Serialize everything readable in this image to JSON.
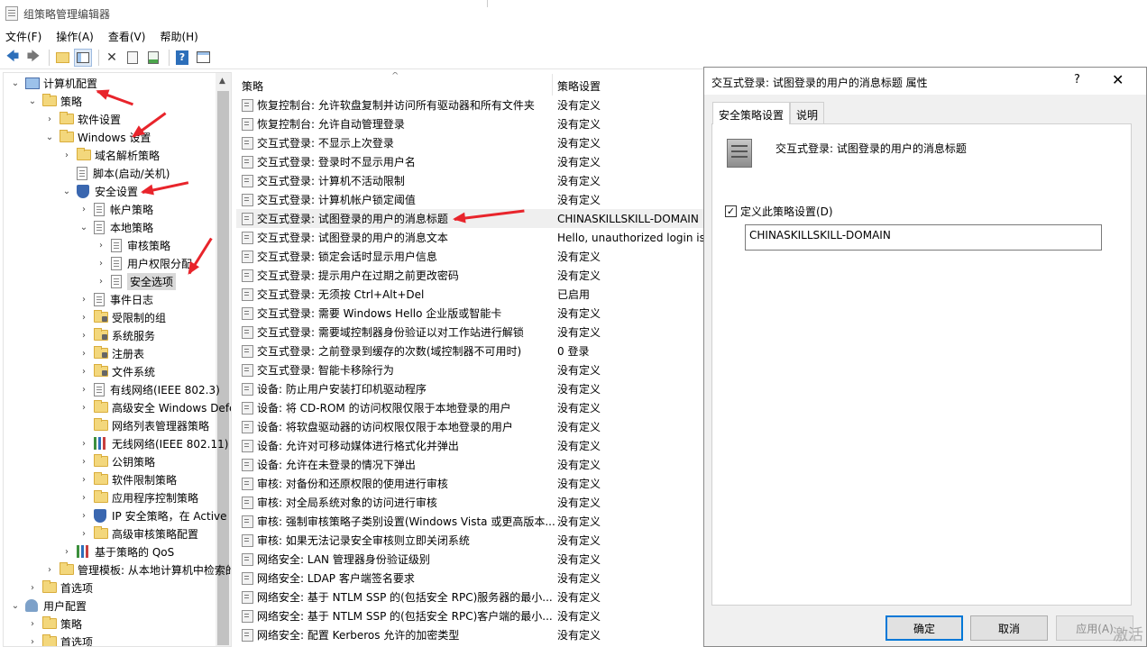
{
  "window": {
    "title": "组策略管理编辑器"
  },
  "menu": [
    "文件(F)",
    "操作(A)",
    "查看(V)",
    "帮助(H)"
  ],
  "toolbar": {
    "icons": [
      "back-arrow-icon",
      "forward-arrow-icon",
      "up-folder-icon",
      "show-hide-tree-icon",
      "delete-icon",
      "properties-icon",
      "export-list-icon",
      "help-icon",
      "console-view-icon"
    ]
  },
  "tree": [
    {
      "label": "计算机配置",
      "depth": 0,
      "expander": "open",
      "icon": "computer"
    },
    {
      "label": "策略",
      "depth": 1,
      "expander": "open",
      "icon": "folder"
    },
    {
      "label": "软件设置",
      "depth": 2,
      "expander": "closed",
      "icon": "folder"
    },
    {
      "label": "Windows 设置",
      "depth": 2,
      "expander": "open",
      "icon": "folder"
    },
    {
      "label": "域名解析策略",
      "depth": 3,
      "expander": "closed",
      "icon": "folder"
    },
    {
      "label": "脚本(启动/关机)",
      "depth": 3,
      "expander": "none",
      "icon": "doc"
    },
    {
      "label": "安全设置",
      "depth": 3,
      "expander": "open",
      "icon": "shield"
    },
    {
      "label": "帐户策略",
      "depth": 4,
      "expander": "closed",
      "icon": "doc"
    },
    {
      "label": "本地策略",
      "depth": 4,
      "expander": "open",
      "icon": "doc"
    },
    {
      "label": "审核策略",
      "depth": 5,
      "expander": "closed",
      "icon": "doc"
    },
    {
      "label": "用户权限分配",
      "depth": 5,
      "expander": "closed",
      "icon": "doc"
    },
    {
      "label": "安全选项",
      "depth": 5,
      "expander": "closed",
      "icon": "doc",
      "selected": true
    },
    {
      "label": "事件日志",
      "depth": 4,
      "expander": "closed",
      "icon": "doc"
    },
    {
      "label": "受限制的组",
      "depth": 4,
      "expander": "closed",
      "icon": "folder-lock"
    },
    {
      "label": "系统服务",
      "depth": 4,
      "expander": "closed",
      "icon": "folder-lock"
    },
    {
      "label": "注册表",
      "depth": 4,
      "expander": "closed",
      "icon": "folder-lock"
    },
    {
      "label": "文件系统",
      "depth": 4,
      "expander": "closed",
      "icon": "folder-lock"
    },
    {
      "label": "有线网络(IEEE 802.3)",
      "depth": 4,
      "expander": "closed",
      "icon": "doc"
    },
    {
      "label": "高级安全 Windows Defender",
      "depth": 4,
      "expander": "closed",
      "icon": "folder"
    },
    {
      "label": "网络列表管理器策略",
      "depth": 4,
      "expander": "none",
      "icon": "folder"
    },
    {
      "label": "无线网络(IEEE 802.11)",
      "depth": 4,
      "expander": "closed",
      "icon": "chart"
    },
    {
      "label": "公钥策略",
      "depth": 4,
      "expander": "closed",
      "icon": "folder"
    },
    {
      "label": "软件限制策略",
      "depth": 4,
      "expander": "closed",
      "icon": "folder"
    },
    {
      "label": "应用程序控制策略",
      "depth": 4,
      "expander": "closed",
      "icon": "folder"
    },
    {
      "label": "IP 安全策略，在 Active Directory",
      "depth": 4,
      "expander": "closed",
      "icon": "shield"
    },
    {
      "label": "高级审核策略配置",
      "depth": 4,
      "expander": "closed",
      "icon": "folder"
    },
    {
      "label": "基于策略的 QoS",
      "depth": 3,
      "expander": "closed",
      "icon": "chart"
    },
    {
      "label": "管理模板: 从本地计算机中检索的策略定义",
      "depth": 2,
      "expander": "closed",
      "icon": "folder"
    },
    {
      "label": "首选项",
      "depth": 1,
      "expander": "closed",
      "icon": "folder"
    },
    {
      "label": "用户配置",
      "depth": 0,
      "expander": "open",
      "icon": "user"
    },
    {
      "label": "策略",
      "depth": 1,
      "expander": "closed",
      "icon": "folder"
    },
    {
      "label": "首选项",
      "depth": 1,
      "expander": "closed",
      "icon": "folder"
    }
  ],
  "list": {
    "headers": {
      "policy": "策略",
      "setting": "策略设置"
    },
    "rows": [
      {
        "name": "恢复控制台: 允许软盘复制并访问所有驱动器和所有文件夹",
        "value": "没有定义"
      },
      {
        "name": "恢复控制台: 允许自动管理登录",
        "value": "没有定义"
      },
      {
        "name": "交互式登录: 不显示上次登录",
        "value": "没有定义"
      },
      {
        "name": "交互式登录: 登录时不显示用户名",
        "value": "没有定义"
      },
      {
        "name": "交互式登录: 计算机不活动限制",
        "value": "没有定义"
      },
      {
        "name": "交互式登录: 计算机帐户锁定阈值",
        "value": "没有定义"
      },
      {
        "name": "交互式登录: 试图登录的用户的消息标题",
        "value": "CHINASKILLSKILL-DOMAIN",
        "selected": true
      },
      {
        "name": "交互式登录: 试图登录的用户的消息文本",
        "value": "Hello, unauthorized login is"
      },
      {
        "name": "交互式登录: 锁定会话时显示用户信息",
        "value": "没有定义"
      },
      {
        "name": "交互式登录: 提示用户在过期之前更改密码",
        "value": "没有定义"
      },
      {
        "name": "交互式登录: 无须按 Ctrl+Alt+Del",
        "value": "已启用"
      },
      {
        "name": "交互式登录: 需要 Windows Hello 企业版或智能卡",
        "value": "没有定义"
      },
      {
        "name": "交互式登录: 需要域控制器身份验证以对工作站进行解锁",
        "value": "没有定义"
      },
      {
        "name": "交互式登录: 之前登录到缓存的次数(域控制器不可用时)",
        "value": "0 登录"
      },
      {
        "name": "交互式登录: 智能卡移除行为",
        "value": "没有定义"
      },
      {
        "name": "设备: 防止用户安装打印机驱动程序",
        "value": "没有定义"
      },
      {
        "name": "设备: 将 CD-ROM 的访问权限仅限于本地登录的用户",
        "value": "没有定义"
      },
      {
        "name": "设备: 将软盘驱动器的访问权限仅限于本地登录的用户",
        "value": "没有定义"
      },
      {
        "name": "设备: 允许对可移动媒体进行格式化并弹出",
        "value": "没有定义"
      },
      {
        "name": "设备: 允许在未登录的情况下弹出",
        "value": "没有定义"
      },
      {
        "name": "审核: 对备份和还原权限的使用进行审核",
        "value": "没有定义"
      },
      {
        "name": "审核: 对全局系统对象的访问进行审核",
        "value": "没有定义"
      },
      {
        "name": "审核: 强制审核策略子类别设置(Windows Vista 或更高版本...",
        "value": "没有定义"
      },
      {
        "name": "审核: 如果无法记录安全审核则立即关闭系统",
        "value": "没有定义"
      },
      {
        "name": "网络安全: LAN 管理器身份验证级别",
        "value": "没有定义"
      },
      {
        "name": "网络安全: LDAP 客户端签名要求",
        "value": "没有定义"
      },
      {
        "name": "网络安全: 基于 NTLM SSP 的(包括安全 RPC)服务器的最小...",
        "value": "没有定义"
      },
      {
        "name": "网络安全: 基于 NTLM SSP 的(包括安全 RPC)客户端的最小...",
        "value": "没有定义"
      },
      {
        "name": "网络安全: 配置 Kerberos 允许的加密类型",
        "value": "没有定义"
      }
    ]
  },
  "dialog": {
    "title": "交互式登录: 试图登录的用户的消息标题 属性",
    "help": "?",
    "close": "✕",
    "tabs": [
      "安全策略设置",
      "说明"
    ],
    "policy_heading": "交互式登录: 试图登录的用户的消息标题",
    "define_label": "定义此策略设置(D)",
    "define_checked": "✓",
    "value": "CHINASKILLSKILL-DOMAIN",
    "buttons": {
      "ok": "确定",
      "cancel": "取消",
      "apply": "应用(A)"
    }
  },
  "watermark": "激活"
}
